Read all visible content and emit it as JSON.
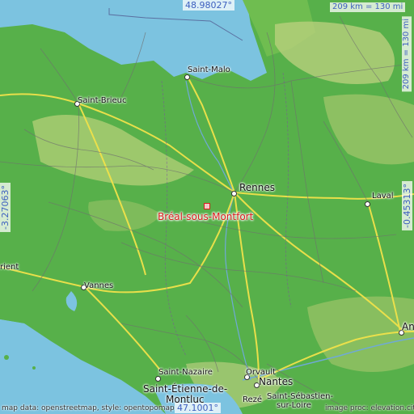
{
  "map": {
    "place_name": "Bréal-sous-Montfort",
    "top_latitude": "48.98027°",
    "bottom_latitude": "47.1001°",
    "left_longitude": "-3.27063°",
    "right_longitude": "-0.45313°",
    "scale": "209 km = 130 mi",
    "credit_left": "map data: openstreetmap, style: opentopomap",
    "credit_right": "image proc: elevation.city",
    "colors": {
      "sea": "#7cc3e0",
      "lowland": "#57b04a",
      "upland": "#c8d68c",
      "roads": "#f0e24a",
      "place": "#d81b1b",
      "coords": "#3d5fbf"
    }
  },
  "cities": {
    "saint_malo": "Saint-Malo",
    "saint_brieuc": "Saint-Brieuc",
    "rennes": "Rennes",
    "laval": "Laval",
    "vannes": "Vannes",
    "lorient": "rient",
    "angers": "An",
    "saint_nazaire": "Saint-Nazaire",
    "saint_etienne": "Saint-Étienne-de-",
    "montluc": "Montluc",
    "orvault": "Orvault",
    "nantes": "Nantes",
    "reze": "Rezé",
    "saint_sebastien": "Saint-Sébastien-",
    "sur_loire": "sur-Loire"
  }
}
